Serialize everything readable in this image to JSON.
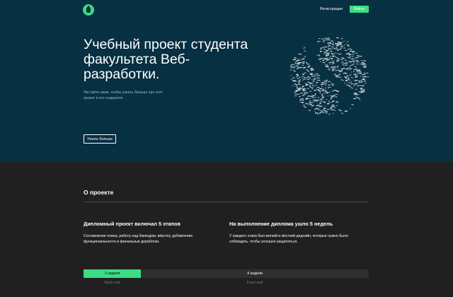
{
  "header": {
    "logo": "android-logo-icon",
    "register_link": "Регистрация",
    "login_button": "Войти"
  },
  "hero": {
    "title": "Учебный проект студента факультета Веб-разработки.",
    "subtitle": "Листайте ниже, чтобы узнать больше про этот проект и его создателя.",
    "more_button": "Узнать больше",
    "globe": "text-globe-graphic"
  },
  "about": {
    "title": "О проекте",
    "stages": {
      "title": "Дипломный проект включал 5 этапов",
      "text": "Составление плана, работу над бэкендом, вёрстку, добавление функциональности и финальные доработки."
    },
    "weeks": {
      "title": "На выполнение диплома ушло 5 недель",
      "text": "У каждого этапа был мягкий и жёсткий дедлайн, которые нужно было соблюдать, чтобы успешно защититься."
    },
    "timeline": {
      "backend_duration": "1 неделя",
      "frontend_duration": "4 недели",
      "backend_label": "Back-end",
      "frontend_label": "Front-end"
    }
  },
  "colors": {
    "hero_bg": "#073042",
    "accent": "#3ddc84",
    "section_bg": "#202020"
  }
}
